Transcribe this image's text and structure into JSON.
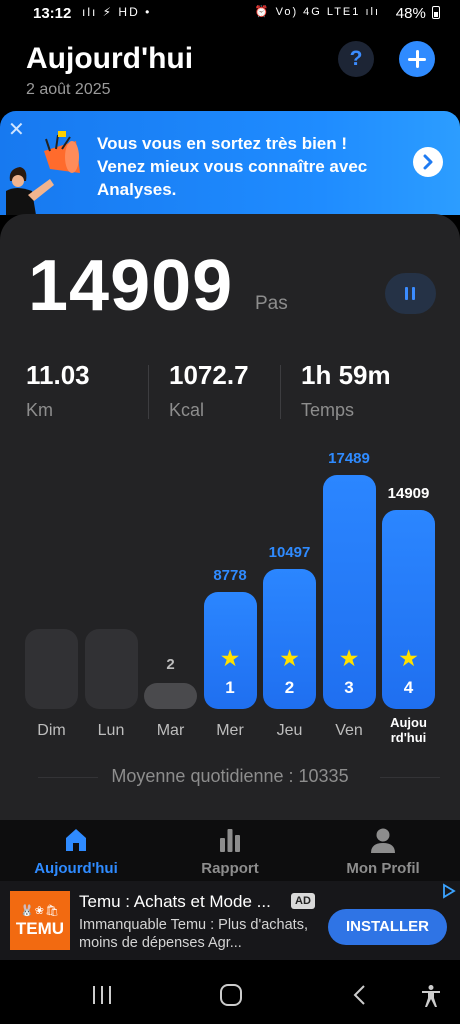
{
  "status_bar": {
    "time": "13:12",
    "left_icons": "ılı ⚡ HD •",
    "right_icons": "⏰ Vo) 4G LTE1 ılı",
    "battery": "48%"
  },
  "header": {
    "title": "Aujourd'hui",
    "date": "2 août 2025",
    "help_label": "?"
  },
  "banner": {
    "close": "✕",
    "text": "Vous vous en sortez très bien ! Venez mieux vous connaître avec Analyses."
  },
  "summary": {
    "steps": "14909",
    "steps_unit": "Pas",
    "stats": [
      {
        "value": "11.03",
        "label": "Km"
      },
      {
        "value": "1072.7",
        "label": "Kcal"
      },
      {
        "value": "1h 59m",
        "label": "Temps"
      }
    ]
  },
  "chart_data": {
    "type": "bar",
    "categories": [
      "Dim",
      "Lun",
      "Mar",
      "Mer",
      "Jeu",
      "Ven",
      "Aujourd'hui"
    ],
    "category_labels": [
      "Dim",
      "Lun",
      "Mar",
      "Mer",
      "Jeu",
      "Ven",
      "Aujou\nrd'hui"
    ],
    "values": [
      0,
      0,
      2,
      8778,
      10497,
      17489,
      14909
    ],
    "value_labels": [
      "",
      "",
      "2",
      "8778",
      "10497",
      "17489",
      "14909"
    ],
    "goal_ranks": [
      null,
      null,
      null,
      "1",
      "2",
      "3",
      "4"
    ],
    "ylim": [
      0,
      17489
    ],
    "colors": {
      "goal_bar": "#2b86ff",
      "empty_bar": "#313134",
      "low_bar": "#4a4a4d",
      "star": "#ffe100"
    }
  },
  "average": {
    "text": "Moyenne quotidienne : 10335"
  },
  "bottom_nav": {
    "items": [
      {
        "label": "Aujourd'hui",
        "icon": "home-icon",
        "active": true
      },
      {
        "label": "Rapport",
        "icon": "bar-chart-icon",
        "active": false
      },
      {
        "label": "Mon Profil",
        "icon": "person-icon",
        "active": false
      }
    ]
  },
  "ad": {
    "logo_text": "TEMU",
    "logo_glyphs": "🐰❀🛍",
    "title": "Temu : Achats et Mode ...",
    "badge": "AD",
    "description": "Immanquable Temu : Plus d'achats, moins de dépenses Agr...",
    "install": "INSTALLER"
  }
}
